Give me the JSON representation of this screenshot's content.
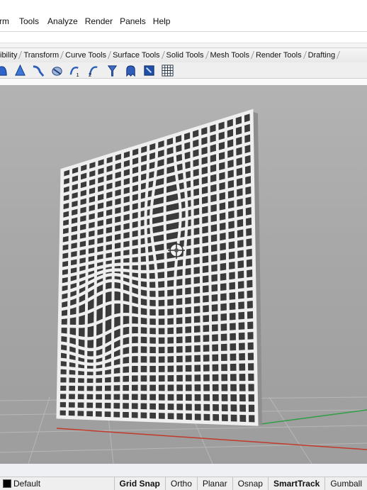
{
  "menu": [
    "rm",
    "Tools",
    "Analyze",
    "Render",
    "Panels",
    "Help"
  ],
  "tabs": [
    "ibility",
    "Transform",
    "Curve Tools",
    "Surface Tools",
    "Solid Tools",
    "Mesh Tools",
    "Render Tools",
    "Drafting"
  ],
  "toolbar_icons": [
    "cage-edit-icon",
    "cone-icon",
    "bend-icon",
    "twist-icon",
    "curve-tools-icon",
    "flow-along-icon",
    "taper-icon",
    "ghosted-display-icon",
    "select-surface-icon",
    "grid-mesh-icon"
  ],
  "status": {
    "layer": "Default",
    "panes": [
      "Grid Snap",
      "Ortho",
      "Planar",
      "Osnap",
      "SmartTrack",
      "Gumball"
    ],
    "active": [
      "Grid Snap",
      "SmartTrack"
    ]
  },
  "colors": {
    "viewport_bg": "#a8a8a8",
    "panel": "#ececec",
    "x_axis": "#c0392b",
    "y_axis": "#2f9e44"
  }
}
